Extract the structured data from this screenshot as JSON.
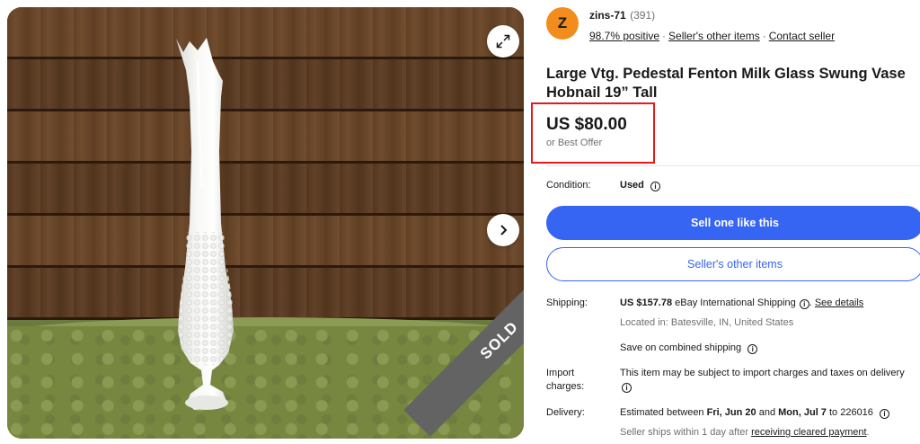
{
  "gallery": {
    "expand_icon": "expand-arrows-icon",
    "next_icon": "chevron-right-icon",
    "sold_label": "SOLD"
  },
  "seller": {
    "avatar_letter": "Z",
    "name": "zins-71",
    "feedback_count": "(391)",
    "positive": "98.7% positive",
    "other_items": "Seller's other items",
    "contact": "Contact seller"
  },
  "listing": {
    "title": "Large Vtg. Pedestal Fenton Milk Glass Swung Vase Hobnail 19” Tall",
    "price": "US $80.00",
    "best_offer": "or Best Offer",
    "condition_label": "Condition:",
    "condition_value": "Used"
  },
  "buttons": {
    "sell_one": "Sell one like this",
    "sellers_other_items": "Seller's other items"
  },
  "shipping": {
    "label": "Shipping:",
    "amount": "US $157.78",
    "method": "eBay International Shipping",
    "see_details": "See details",
    "located": "Located in: Batesville, IN, United States",
    "combined": "Save on combined shipping"
  },
  "import": {
    "label_line1": "Import",
    "label_line2": "charges:",
    "text": "This item may be subject to import charges and taxes on delivery"
  },
  "delivery": {
    "label": "Delivery:",
    "prefix": "Estimated between",
    "date1": "Fri, Jun 20",
    "and": "and",
    "date2": "Mon, Jul 7",
    "to": "to 226016",
    "ships_prefix": "Seller ships within 1 day after",
    "ships_link": "receiving cleared payment",
    "ships_suffix": "."
  },
  "colors": {
    "accent": "#3665f3",
    "avatar": "#f18c1d",
    "price_highlight": "#e41b1b",
    "sold_ribbon": "#636363"
  }
}
